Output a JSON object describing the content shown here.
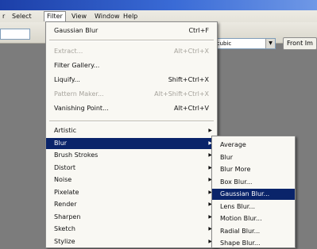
{
  "menubar": {
    "items": [
      "Select",
      "Filter",
      "View",
      "Window",
      "Help"
    ],
    "partial_left": "r"
  },
  "options_bar": {
    "combo_value": "Bicubic",
    "button_label": "Front Im"
  },
  "filter_menu": {
    "last_filter": {
      "label": "Gaussian Blur",
      "shortcut": "Ctrl+F"
    },
    "group1": [
      {
        "label": "Extract...",
        "shortcut": "Alt+Ctrl+X",
        "disabled": true
      },
      {
        "label": "Filter Gallery...",
        "shortcut": "",
        "disabled": false
      },
      {
        "label": "Liquify...",
        "shortcut": "Shift+Ctrl+X",
        "disabled": false
      },
      {
        "label": "Pattern Maker...",
        "shortcut": "Alt+Shift+Ctrl+X",
        "disabled": true
      },
      {
        "label": "Vanishing Point...",
        "shortcut": "Alt+Ctrl+V",
        "disabled": false
      }
    ],
    "categories": [
      "Artistic",
      "Blur",
      "Brush Strokes",
      "Distort",
      "Noise",
      "Pixelate",
      "Render",
      "Sharpen",
      "Sketch",
      "Stylize"
    ],
    "highlighted_category": "Blur"
  },
  "blur_submenu": {
    "items": [
      "Average",
      "Blur",
      "Blur More",
      "Box Blur...",
      "Gaussian Blur...",
      "Lens Blur...",
      "Motion Blur...",
      "Radial Blur...",
      "Shape Blur..."
    ],
    "highlighted_item": "Gaussian Blur..."
  },
  "colors": {
    "highlight": "#0a246a",
    "menu_bg": "#f9f8f3",
    "workspace": "#7c7c7c"
  }
}
